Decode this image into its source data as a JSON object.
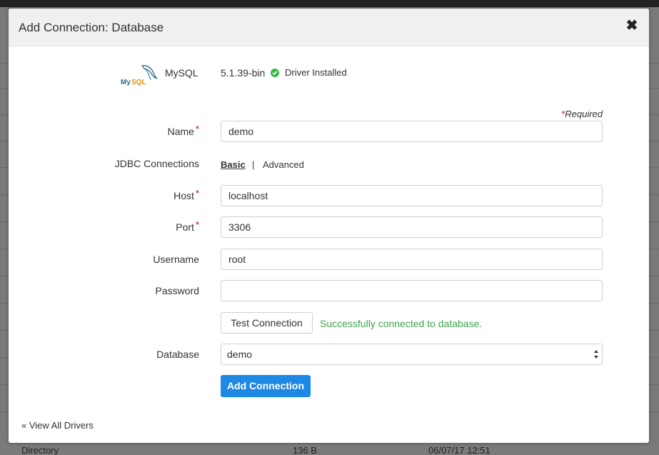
{
  "modal": {
    "title": "Add Connection: Database",
    "close_glyph": "✖"
  },
  "driver": {
    "logo": "mysql-logo",
    "name": "MySQL",
    "version": "5.1.39-bin",
    "status": "Driver Installed",
    "status_color": "#3ab54a"
  },
  "form": {
    "required_note": "Required",
    "required_star": "*",
    "name": {
      "label": "Name",
      "value": "demo",
      "required": true
    },
    "jdbc": {
      "label": "JDBC Connections",
      "basic": "Basic",
      "separator": "|",
      "advanced": "Advanced"
    },
    "host": {
      "label": "Host",
      "value": "localhost",
      "required": true
    },
    "port": {
      "label": "Port",
      "value": "3306",
      "required": true
    },
    "username": {
      "label": "Username",
      "value": "root"
    },
    "password": {
      "label": "Password",
      "value": ""
    },
    "test_button": "Test Connection",
    "test_message": "Successfully connected to database.",
    "test_message_color": "#3fa34d",
    "database": {
      "label": "Database",
      "selected": "demo"
    },
    "add_button": "Add Connection",
    "add_button_color": "#1e88e5"
  },
  "footer": {
    "view_all": "« View All Drivers"
  },
  "background_row": {
    "name": "Directory",
    "size": "136 B",
    "modified": "06/07/17 12:51"
  }
}
